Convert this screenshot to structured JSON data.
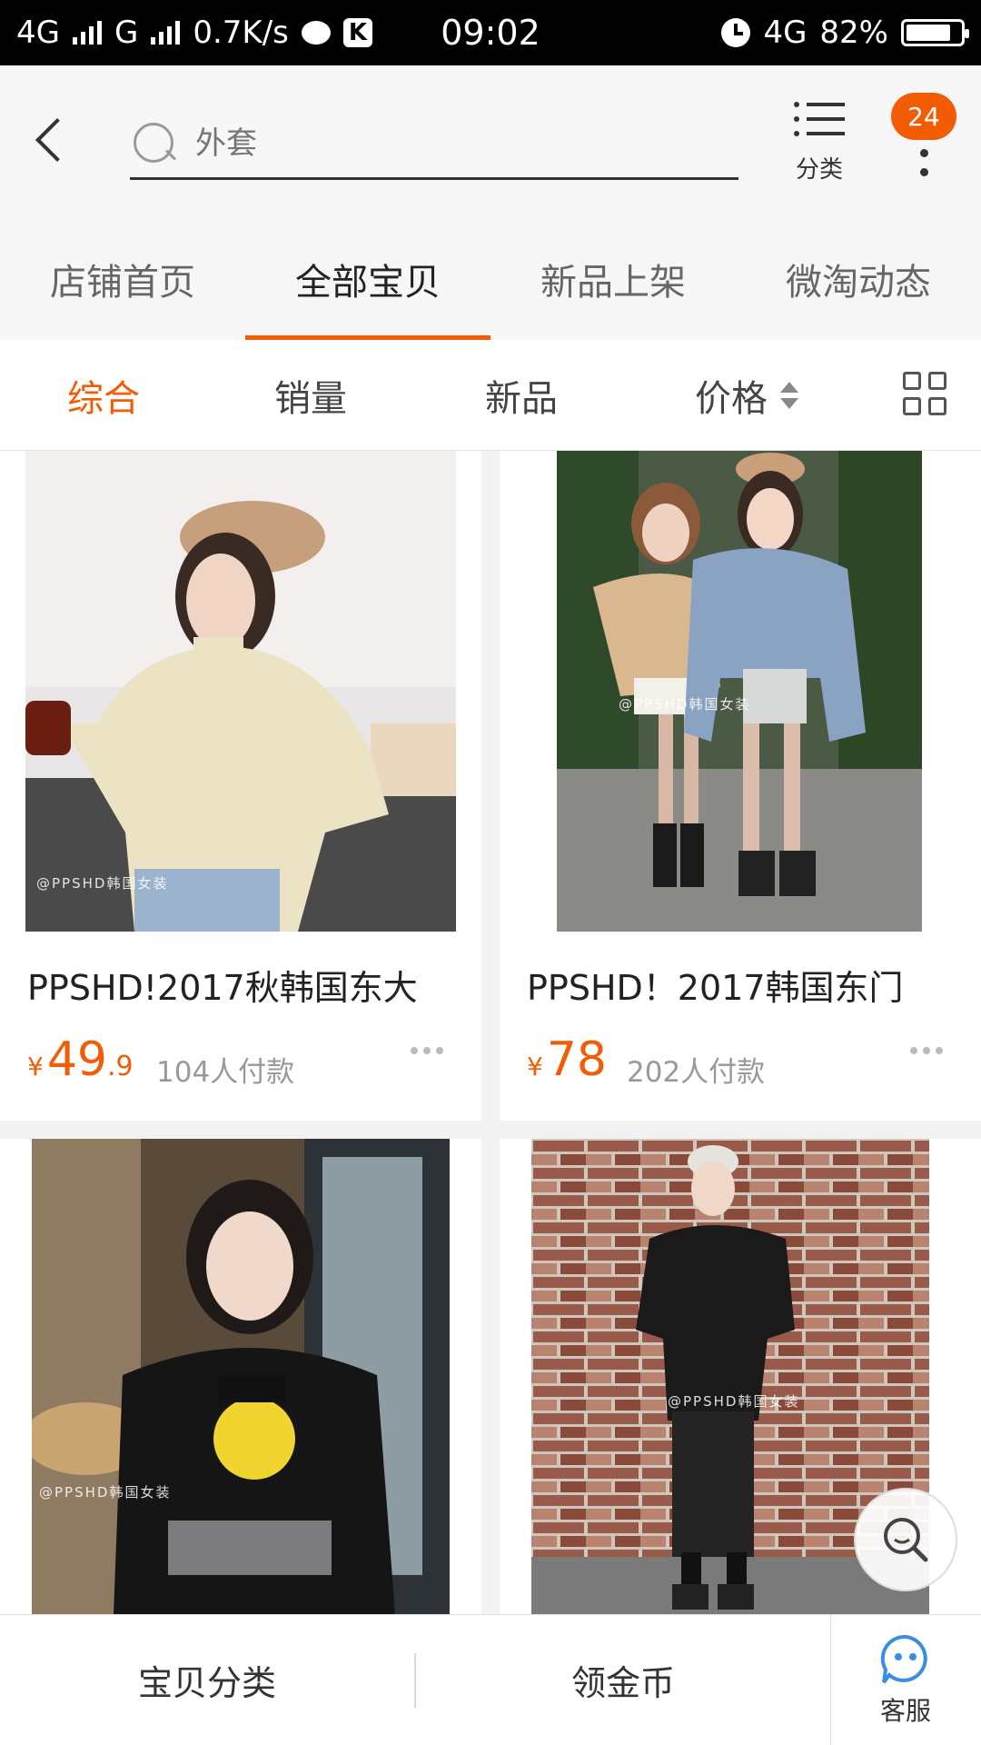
{
  "status_bar": {
    "network1": "4G",
    "network2": "G",
    "speed": "0.7K/s",
    "time": "09:02",
    "network3": "4G",
    "battery": "82%",
    "k_label": "K"
  },
  "header": {
    "search_placeholder": "外套",
    "category_label": "分类",
    "badge_count": "24"
  },
  "tabs": [
    {
      "label": "店铺首页",
      "active": false
    },
    {
      "label": "全部宝贝",
      "active": true
    },
    {
      "label": "新品上架",
      "active": false
    },
    {
      "label": "微淘动态",
      "active": false
    }
  ],
  "sort": {
    "items": [
      "综合",
      "销量",
      "新品",
      "价格"
    ],
    "active_index": 0
  },
  "products": [
    {
      "title": "PPSHD!2017秋韩国东大",
      "price_yen": "¥",
      "price_int": "49",
      "price_dec": ".9",
      "sold": "104人付款",
      "watermark": "@PPSHD韩国女装"
    },
    {
      "title": "PPSHD！2017韩国东门",
      "price_yen": "¥",
      "price_int": "78",
      "price_dec": "",
      "sold": "202人付款",
      "watermark": "@PPSHD韩国女装"
    },
    {
      "watermark": "@PPSHD韩国女装"
    },
    {
      "watermark": "@PPSHD韩国女装"
    }
  ],
  "bottom_bar": {
    "item1": "宝贝分类",
    "item2": "领金币",
    "service": "客服"
  },
  "colors": {
    "accent": "#f25c05",
    "status_bg": "#000000",
    "service_icon": "#3a8de0"
  }
}
